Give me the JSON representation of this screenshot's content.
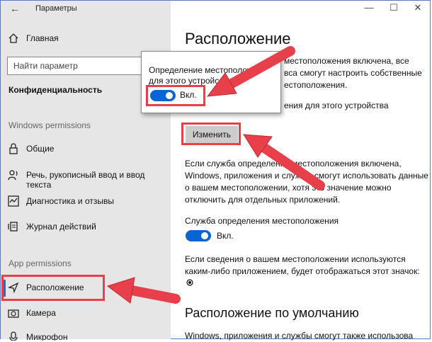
{
  "window": {
    "title": "Параметры",
    "back_icon": "arrow-left-icon"
  },
  "sidebar": {
    "home": "Главная",
    "search_placeholder": "Найти параметр",
    "category": "Конфиденциальность",
    "windows_permissions_header": "Windows permissions",
    "app_permissions_header": "App permissions",
    "items": [
      {
        "label": "Общие",
        "icon": "lock-icon"
      },
      {
        "label": "Речь, рукописный ввод и ввод текста",
        "icon": "speech-icon"
      },
      {
        "label": "Диагностика и отзывы",
        "icon": "diagnostics-icon"
      },
      {
        "label": "Журнал действий",
        "icon": "activity-history-icon"
      },
      {
        "label": "Расположение",
        "icon": "location-icon",
        "active": true
      },
      {
        "label": "Камера",
        "icon": "camera-icon"
      },
      {
        "label": "Микрофон",
        "icon": "microphone-icon"
      }
    ]
  },
  "main": {
    "title": "Расположение",
    "status_partial": {
      "line1": "местоположения включена, все",
      "line2": "вса смогут настроить собственные",
      "line3": "естоположения.",
      "line4": "ения для этого устройства"
    },
    "change_button": "Изменить",
    "description": {
      "line1": "Если служба определения местоположения включена,",
      "line2": "Windows, приложения и службы смогут использовать данные",
      "line3": "о вашем местоположении, хотя это значение можно",
      "line4": "отключить для отдельных приложений."
    },
    "service_label": "Служба определения местоположения",
    "service_toggle_state": "Вкл.",
    "usage_note": {
      "line1": "Если сведения о вашем местоположении используются",
      "line2": "каким-либо приложением, будет отображаться этот значок:"
    },
    "default_location_title": "Расположение по умолчанию",
    "default_location_text": "Windows, приложения и службы смогут также использова"
  },
  "popup": {
    "line1": "Определение местоположе",
    "line2": "для этого устройс",
    "toggle_state": "Вкл."
  },
  "colors": {
    "accent": "#0a64d6",
    "highlight": "#e8404a",
    "sidebar_bg": "#e6e6e6"
  }
}
